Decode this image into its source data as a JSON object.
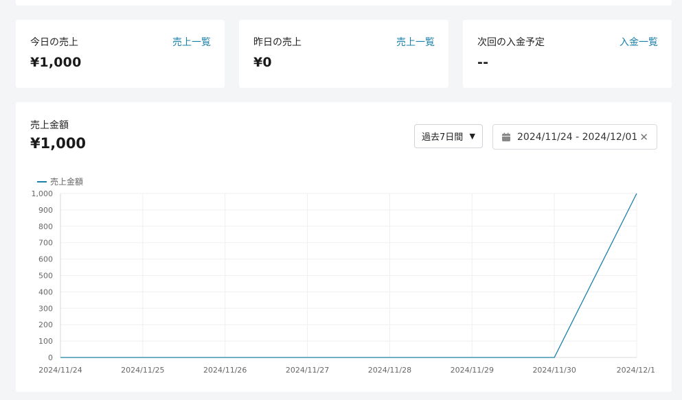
{
  "stats": [
    {
      "label": "今日の売上",
      "link": "売上一覧",
      "value": "¥1,000"
    },
    {
      "label": "昨日の売上",
      "link": "売上一覧",
      "value": "¥0"
    },
    {
      "label": "次回の入金予定",
      "link": "入金一覧",
      "value": "--"
    }
  ],
  "sales": {
    "title": "売上金額",
    "total": "¥1,000",
    "range_select": "過去7日間",
    "date_range": "2024/11/24 - 2024/12/01"
  },
  "colors": {
    "accent": "#1a7fa8",
    "line": "#1a7fa8"
  },
  "icons": {
    "calendar": "calendar-icon",
    "clear": "close-icon",
    "select": "chevron-down-icon"
  },
  "chart_data": {
    "type": "line",
    "legend_position": "top-left",
    "grid": true,
    "series": [
      {
        "name": "売上金額",
        "values": [
          0,
          0,
          0,
          0,
          0,
          0,
          0,
          1000
        ]
      }
    ],
    "categories": [
      "2024/11/24",
      "2024/11/25",
      "2024/11/26",
      "2024/11/27",
      "2024/11/28",
      "2024/11/29",
      "2024/11/30",
      "2024/12/1"
    ],
    "y_ticks": [
      "0",
      "100",
      "200",
      "300",
      "400",
      "500",
      "600",
      "700",
      "800",
      "900",
      "1,000"
    ],
    "ylim": [
      0,
      1000
    ]
  }
}
